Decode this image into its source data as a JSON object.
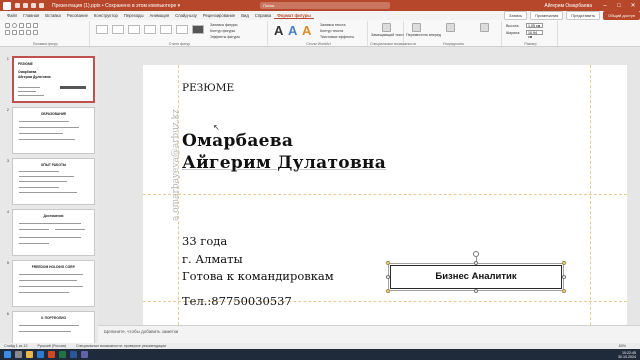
{
  "titlebar": {
    "doc_title": "Презентация (1).pptx • Сохранено в этом компьютере ▾",
    "search_placeholder": "Поиск",
    "user": "Айгерим Омарбаева"
  },
  "tabs": [
    "Файл",
    "Главная",
    "Вставка",
    "Рисование",
    "Конструктор",
    "Переходы",
    "Анимация",
    "Слайд-шоу",
    "Рецензирование",
    "Вид",
    "Справка",
    "Формат фигуры"
  ],
  "active_tab_index": 11,
  "tab_buttons": {
    "record": "Запись",
    "comments": "Примечания",
    "present": "Представить",
    "share": "Общий доступ"
  },
  "ribbon": {
    "groups": [
      "Вставка фигур",
      "Стили фигур",
      "Стили WordArt",
      "Специальные возможности",
      "Упорядочить",
      "Размер"
    ],
    "fill_label": "Заливка фигуры",
    "outline_label": "Контур фигуры",
    "effects_label": "Эффекты фигуры",
    "text_fill_label": "Заливка текста",
    "text_outline_label": "Контур текста",
    "text_effects_label": "Текстовые эффекты",
    "alt_text_label": "Замещающий текст",
    "forward_label": "Переместить вперед",
    "backward_label": "Переместить назад",
    "selection_label": "Область выделения",
    "height_label": "Высота:",
    "height_value": "1,05 см",
    "width_label": "Ширина:",
    "width_value": "10,94 см"
  },
  "thumbnails": [
    {
      "num": "1",
      "lines": [
        "РЕЗЮМЕ",
        "Омарбаева",
        "Айгерим Дулатовна"
      ]
    },
    {
      "num": "2",
      "lines": [
        "ОБРАЗОВАНИЕ"
      ]
    },
    {
      "num": "3",
      "lines": [
        "ОПЫТ РАБОТЫ"
      ]
    },
    {
      "num": "4",
      "lines": [
        "Достижения"
      ]
    },
    {
      "num": "5",
      "lines": [
        "FREEDOM HOLDING CORP."
      ]
    },
    {
      "num": "6",
      "lines": [
        "II. ПОРТФОЛИО"
      ]
    }
  ],
  "slide": {
    "resume": "РЕЗЮМЕ",
    "surname": "Омарбаева",
    "given_names": "Айгерим Дулатовна",
    "age": "33 года",
    "city": "г. Алматы",
    "travel": "Готова к командировкам",
    "phone": "Тел.:87750030537",
    "email": "a.omarbayeva@arbuz.kz",
    "shape_text": "Бизнес Аналитик"
  },
  "notes_placeholder": "Щелкните, чтобы добавить заметки",
  "status": {
    "slide_info": "Слайд 1 из 12",
    "language": "Русский (Россия)",
    "accessibility": "Специальные возможности: проверьте рекомендации",
    "zoom": "83%"
  },
  "taskbar": {
    "time": "10:22:45",
    "date": "30.10.2024"
  }
}
